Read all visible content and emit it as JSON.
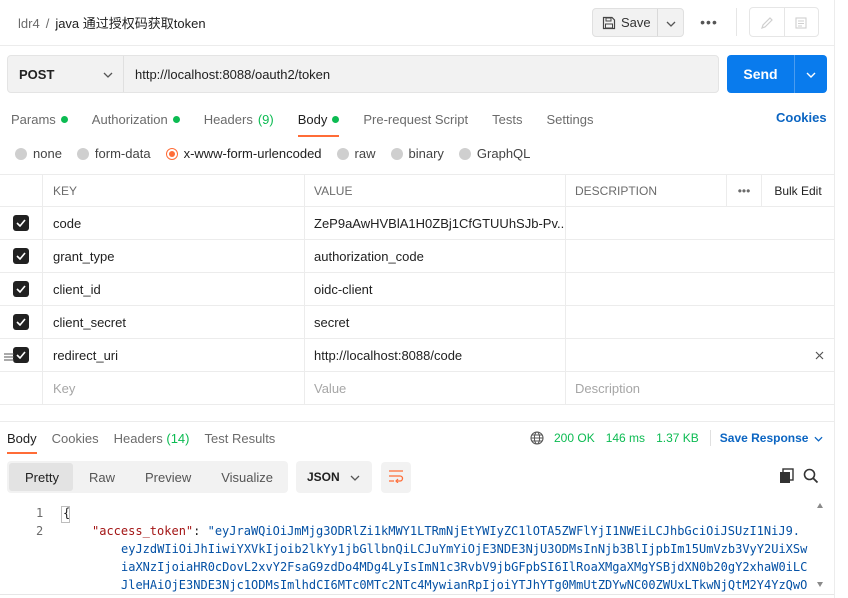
{
  "header": {
    "workspace": "ldr4",
    "separator": "/",
    "request_name": "java 通过授权码获取token",
    "save_label": "Save",
    "more_label": "•••"
  },
  "request": {
    "method": "POST",
    "url": "http://localhost:8088/oauth2/token",
    "send_label": "Send"
  },
  "request_tabs": [
    {
      "label": "Params",
      "dot": true
    },
    {
      "label": "Authorization",
      "dot": true
    },
    {
      "label": "Headers",
      "count": "(9)"
    },
    {
      "label": "Body",
      "dot": true,
      "active": true
    },
    {
      "label": "Pre-request Script"
    },
    {
      "label": "Tests"
    },
    {
      "label": "Settings"
    }
  ],
  "cookies_label": "Cookies",
  "body_types": [
    {
      "label": "none"
    },
    {
      "label": "form-data"
    },
    {
      "label": "x-www-form-urlencoded",
      "selected": true
    },
    {
      "label": "raw"
    },
    {
      "label": "binary"
    },
    {
      "label": "GraphQL"
    }
  ],
  "table": {
    "headers": {
      "key": "KEY",
      "value": "VALUE",
      "description": "DESCRIPTION",
      "more": "•••",
      "bulk_edit": "Bulk Edit"
    },
    "rows": [
      {
        "key": "code",
        "value": "ZeP9aAwHVBlA1H0ZBj1CfGTUUhSJb-Pv..."
      },
      {
        "key": "grant_type",
        "value": "authorization_code"
      },
      {
        "key": "client_id",
        "value": "oidc-client"
      },
      {
        "key": "client_secret",
        "value": "secret"
      },
      {
        "key": "redirect_uri",
        "value": "http://localhost:8088/code"
      }
    ],
    "placeholder": {
      "key": "Key",
      "value": "Value",
      "description": "Description"
    }
  },
  "response": {
    "tabs": [
      {
        "label": "Body",
        "active": true
      },
      {
        "label": "Cookies"
      },
      {
        "label": "Headers",
        "count": "(14)"
      },
      {
        "label": "Test Results"
      }
    ],
    "status": "200 OK",
    "time": "146 ms",
    "size": "1.37 KB",
    "save_response_label": "Save Response",
    "formats": [
      "Pretty",
      "Raw",
      "Preview",
      "Visualize"
    ],
    "language": "JSON",
    "code": {
      "line_numbers": [
        "1",
        "2"
      ],
      "open_brace": "{",
      "key": "\"access_token\"",
      "colon": ": ",
      "lines": [
        "\"eyJraWQiOiJmMjg3ODRlZi1kMWY1LTRmNjEtYWIyZC1lOTA5ZWFlYjI1NWEiLCJhbGciOiJSUzI1NiJ9.",
        "eyJzdWIiOiJhIiwiYXVkIjoib2lkYy1jbGllbnQiLCJuYmYiOjE3NDE3NjU3ODMsInNjb3BlIjpbIm15UmVzb3VyY2UiXSw",
        "iaXNzIjoiaHR0cDovL2xvY2FsaG9zdDo4MDg4LyIsImN1c3RvbV9jbGFpbSI6IlRoaXMgaXMgYSBjdXN0b20gY2xhaW0iLC",
        "JleHAiOjE3NDE3Njc1ODMsImlhdCI6MTc0MTc2NTc4MywianRpIjoiYTJhYTg0MmUtZDYwNC00ZWUxLTkwNjQtM2Y4YzQwO"
      ]
    }
  },
  "colors": {
    "accent": "#ff6c37",
    "primary": "#097bed",
    "success": "#0cbb52",
    "link": "#0b65c2"
  }
}
